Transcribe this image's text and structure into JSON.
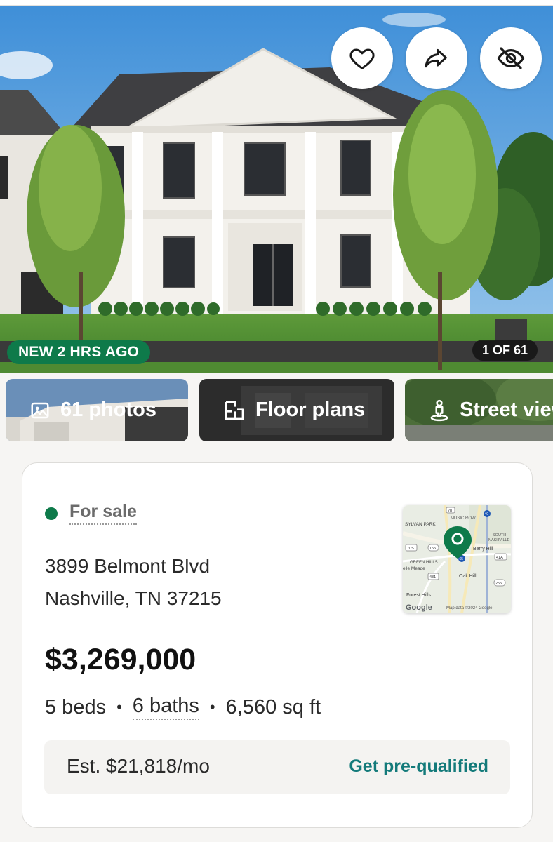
{
  "hero": {
    "badge_new": "NEW 2 HRS AGO",
    "photo_count": "1 OF 61",
    "actions": [
      {
        "name": "save",
        "icon": "heart-icon"
      },
      {
        "name": "share",
        "icon": "share-arrow-icon"
      },
      {
        "name": "hide",
        "icon": "eye-slash-icon"
      }
    ]
  },
  "media_tiles": [
    {
      "label": "61 photos",
      "icon": "image-icon"
    },
    {
      "label": "Floor plans",
      "icon": "floor-plan-icon"
    },
    {
      "label": "Street view",
      "icon": "street-view-pegman-icon"
    }
  ],
  "listing": {
    "status": "For sale",
    "address_line1": "3899 Belmont Blvd",
    "address_line2": "Nashville, TN 37215",
    "price": "$3,269,000",
    "beds": "5 beds",
    "baths": "6 baths",
    "sqft": "6,560 sq ft",
    "sep": "•",
    "est_payment": "Est. $21,818/mo",
    "prequal_label": "Get pre-qualified"
  },
  "map": {
    "labels": {
      "music_row": "MUSIC ROW",
      "sylvan_park": "SYLVAN PARK",
      "south": "SOUTH",
      "nashville": "NASHVILLE",
      "berry_hill": "Berry Hill",
      "green_hills": "GREEN HILLS",
      "belle_meade": "elle Meade",
      "oak_hill": "Oak Hill",
      "forest_hills": "Forest Hills",
      "google": "Google",
      "attribution": "Map data ©2024 Google",
      "shield_70": "70",
      "shield_40": "40",
      "shield_70s": "70S",
      "shield_155": "155",
      "shield_41a": "41A",
      "shield_65": "65",
      "shield_431": "431",
      "shield_255": "255"
    }
  },
  "colors": {
    "brand_green": "#0e7a4a",
    "link_teal": "#137a7a"
  }
}
